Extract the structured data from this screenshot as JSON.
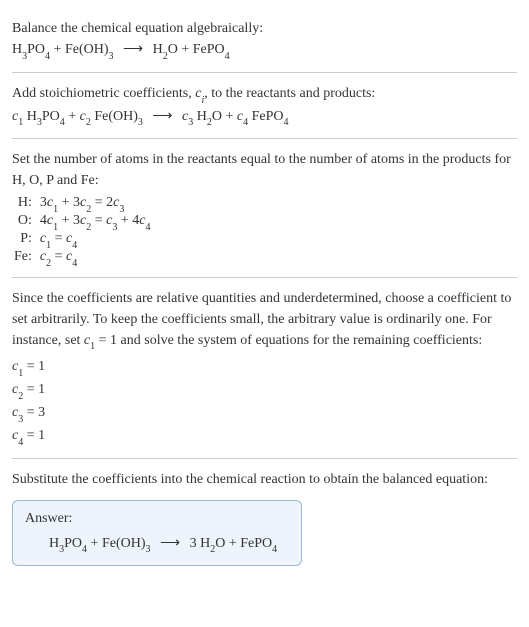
{
  "s1": {
    "intro": "Balance the chemical equation algebraically:"
  },
  "s2": {
    "intro": "Add stoichiometric coefficients, ",
    "ci": "c",
    "ci_sub": "i",
    "intro2": ", to the reactants and products:"
  },
  "s3": {
    "intro": "Set the number of atoms in the reactants equal to the number of atoms in the products for H, O, P and Fe:",
    "rows": {
      "H": {
        "label": "H:"
      },
      "O": {
        "label": "O:"
      },
      "P": {
        "label": "P:"
      },
      "Fe": {
        "label": "Fe:"
      }
    }
  },
  "s4": {
    "intro": "Since the coefficients are relative quantities and underdetermined, choose a coefficient to set arbitrarily. To keep the coefficients small, the arbitrary value is ordinarily one. For instance, set ",
    "set_c": "c",
    "set_sub": "1",
    "set_after": " = 1 and solve the system of equations for the remaining coefficients:",
    "c1": "1",
    "c2": "1",
    "c3": "3",
    "c4": "1"
  },
  "s5": {
    "intro": "Substitute the coefficients into the chemical reaction to obtain the balanced equation:",
    "answer_label": "Answer:"
  },
  "chem": {
    "H3PO4_H": "H",
    "H3PO4_3": "3",
    "H3PO4_PO": "PO",
    "H3PO4_4": "4",
    "plus": " + ",
    "FeOH_Fe": "Fe(OH)",
    "FeOH_3": "3",
    "arrow": "⟶",
    "H2O_H": "H",
    "H2O_2": "2",
    "H2O_O": "O",
    "FePO4_Fe": "FePO",
    "FePO4_4": "4",
    "three": "3 "
  },
  "coef": {
    "c": "c",
    "s1": "1",
    "s2": "2",
    "s3": "3",
    "s4": "4",
    "sp": " "
  },
  "eq3": {
    "H_lhs_a": "3",
    "H_lhs_b": " + 3",
    "H_rhs": " = 2",
    "O_lhs_a": "4",
    "O_lhs_b": " + 3",
    "O_rhs_a": " = ",
    "O_rhs_b": " + 4",
    "P_rhs": " = ",
    "Fe_rhs": " = "
  },
  "eq4": {
    "eq": " = "
  }
}
